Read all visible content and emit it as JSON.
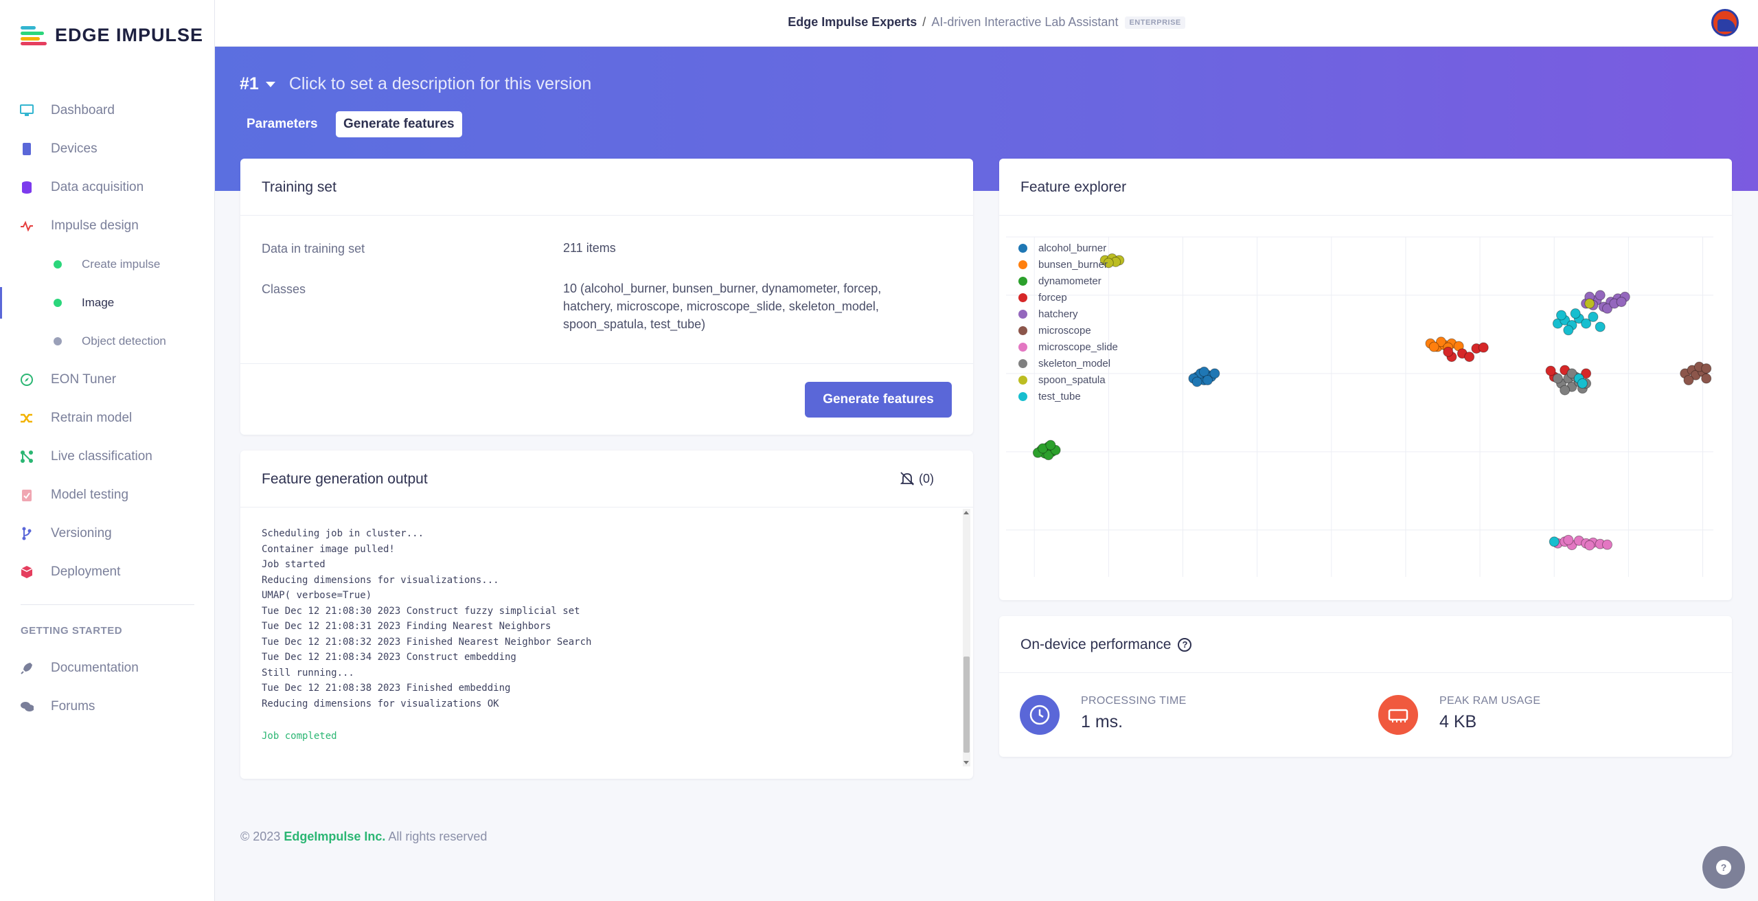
{
  "brand": {
    "name": "EDGE IMPULSE"
  },
  "sidebar": {
    "items": [
      {
        "label": "Dashboard",
        "icon": "monitor-icon",
        "color": "#33b5d0"
      },
      {
        "label": "Devices",
        "icon": "chip-icon",
        "color": "#5a67d8"
      },
      {
        "label": "Data acquisition",
        "icon": "database-icon",
        "color": "#7c3aed"
      },
      {
        "label": "Impulse design",
        "icon": "pulse-icon",
        "color": "#e53e3e"
      },
      {
        "label": "Create impulse",
        "icon": "dot-icon",
        "color": "#2bd67b"
      },
      {
        "label": "Image",
        "icon": "dot-icon",
        "color": "#2bd67b"
      },
      {
        "label": "Object detection",
        "icon": "dot-icon",
        "color": "#9aa0b8"
      },
      {
        "label": "EON Tuner",
        "icon": "compass-icon",
        "color": "#2bb673"
      },
      {
        "label": "Retrain model",
        "icon": "shuffle-icon",
        "color": "#f2b200"
      },
      {
        "label": "Live classification",
        "icon": "network-icon",
        "color": "#2bb673"
      },
      {
        "label": "Model testing",
        "icon": "clipboard-check-icon",
        "color": "#e88a9a"
      },
      {
        "label": "Versioning",
        "icon": "branch-icon",
        "color": "#5a67d8"
      },
      {
        "label": "Deployment",
        "icon": "cube-icon",
        "color": "#e53e5e"
      }
    ],
    "getting_started_title": "GETTING STARTED",
    "getting_started": [
      {
        "label": "Documentation",
        "icon": "rocket-icon"
      },
      {
        "label": "Forums",
        "icon": "chat-icon"
      }
    ]
  },
  "header": {
    "org": "Edge Impulse Experts",
    "separator": "/",
    "project": "AI-driven Interactive Lab Assistant",
    "badge": "ENTERPRISE"
  },
  "banner": {
    "version": "#1",
    "description": "Click to set a description for this version",
    "tabs": [
      {
        "label": "Parameters",
        "active": false
      },
      {
        "label": "Generate features",
        "active": true
      }
    ]
  },
  "training_set": {
    "title": "Training set",
    "rows": [
      {
        "key": "Data in training set",
        "value": "211 items"
      },
      {
        "key": "Classes",
        "value": "10 (alcohol_burner, bunsen_burner, dynamometer, forcep, hatchery, microscope, microscope_slide, skeleton_model, spoon_spatula, test_tube)"
      }
    ],
    "button": "Generate features"
  },
  "output": {
    "title": "Feature generation output",
    "notification_count": "(0)",
    "log": [
      "Scheduling job in cluster...",
      "Container image pulled!",
      "Job started",
      "Reducing dimensions for visualizations...",
      "UMAP( verbose=True)",
      "Tue Dec 12 21:08:30 2023 Construct fuzzy simplicial set",
      "Tue Dec 12 21:08:31 2023 Finding Nearest Neighbors",
      "Tue Dec 12 21:08:32 2023 Finished Nearest Neighbor Search",
      "Tue Dec 12 21:08:34 2023 Construct embedding",
      "Still running...",
      "Tue Dec 12 21:08:38 2023 Finished embedding",
      "Reducing dimensions for visualizations OK"
    ],
    "done": "Job completed"
  },
  "explorer": {
    "title": "Feature explorer",
    "chart_data": {
      "type": "scatter",
      "title": "",
      "xlabel": "",
      "ylabel": "",
      "xlim": [
        0,
        1
      ],
      "ylim": [
        0,
        1
      ],
      "grid": true,
      "legend": "top-left",
      "series": [
        {
          "name": "alcohol_burner",
          "color": "#1f77b4",
          "points": [
            [
              0.27,
              0.58
            ],
            [
              0.28,
              0.57
            ],
            [
              0.275,
              0.59
            ],
            [
              0.285,
              0.585
            ],
            [
              0.265,
              0.575
            ],
            [
              0.29,
              0.58
            ],
            [
              0.28,
              0.595
            ],
            [
              0.27,
              0.565
            ],
            [
              0.285,
              0.57
            ],
            [
              0.295,
              0.59
            ]
          ]
        },
        {
          "name": "bunsen_burner",
          "color": "#ff7f0e",
          "points": [
            [
              0.6,
              0.68
            ],
            [
              0.61,
              0.67
            ],
            [
              0.62,
              0.675
            ],
            [
              0.63,
              0.68
            ],
            [
              0.64,
              0.672
            ],
            [
              0.615,
              0.685
            ],
            [
              0.605,
              0.67
            ],
            [
              0.625,
              0.668
            ]
          ]
        },
        {
          "name": "dynamometer",
          "color": "#2ca02c",
          "points": [
            [
              0.05,
              0.36
            ],
            [
              0.06,
              0.37
            ],
            [
              0.055,
              0.35
            ],
            [
              0.065,
              0.355
            ],
            [
              0.045,
              0.352
            ],
            [
              0.06,
              0.345
            ],
            [
              0.07,
              0.36
            ],
            [
              0.052,
              0.365
            ],
            [
              0.063,
              0.375
            ]
          ]
        },
        {
          "name": "forcep",
          "color": "#d62728",
          "points": [
            [
              0.63,
              0.64
            ],
            [
              0.645,
              0.65
            ],
            [
              0.655,
              0.64
            ],
            [
              0.665,
              0.665
            ],
            [
              0.675,
              0.668
            ],
            [
              0.625,
              0.655
            ],
            [
              0.775,
              0.58
            ],
            [
              0.79,
              0.6
            ],
            [
              0.81,
              0.575
            ],
            [
              0.82,
              0.59
            ],
            [
              0.77,
              0.598
            ]
          ]
        },
        {
          "name": "hatchery",
          "color": "#9467bd",
          "points": [
            [
              0.82,
              0.8
            ],
            [
              0.835,
              0.81
            ],
            [
              0.845,
              0.79
            ],
            [
              0.855,
              0.805
            ],
            [
              0.865,
              0.815
            ],
            [
              0.875,
              0.82
            ],
            [
              0.84,
              0.825
            ],
            [
              0.85,
              0.785
            ],
            [
              0.86,
              0.8
            ],
            [
              0.83,
              0.795
            ],
            [
              0.87,
              0.805
            ],
            [
              0.825,
              0.82
            ]
          ]
        },
        {
          "name": "microscope",
          "color": "#8c564b",
          "points": [
            [
              0.96,
              0.59
            ],
            [
              0.97,
              0.6
            ],
            [
              0.975,
              0.585
            ],
            [
              0.985,
              0.595
            ],
            [
              0.99,
              0.575
            ],
            [
              0.98,
              0.61
            ],
            [
              0.965,
              0.57
            ],
            [
              0.99,
              0.605
            ]
          ]
        },
        {
          "name": "microscope_slide",
          "color": "#e377c2",
          "points": [
            [
              0.78,
              0.08
            ],
            [
              0.79,
              0.085
            ],
            [
              0.8,
              0.075
            ],
            [
              0.81,
              0.088
            ],
            [
              0.82,
              0.08
            ],
            [
              0.83,
              0.082
            ],
            [
              0.84,
              0.078
            ],
            [
              0.85,
              0.076
            ],
            [
              0.795,
              0.09
            ],
            [
              0.825,
              0.074
            ]
          ]
        },
        {
          "name": "skeleton_model",
          "color": "#7f7f7f",
          "points": [
            [
              0.785,
              0.56
            ],
            [
              0.795,
              0.575
            ],
            [
              0.8,
              0.55
            ],
            [
              0.81,
              0.565
            ],
            [
              0.79,
              0.54
            ],
            [
              0.805,
              0.58
            ],
            [
              0.815,
              0.545
            ],
            [
              0.78,
              0.575
            ],
            [
              0.8,
              0.59
            ],
            [
              0.82,
              0.56
            ]
          ]
        },
        {
          "name": "spoon_spatula",
          "color": "#bcbd22",
          "points": [
            [
              0.14,
              0.93
            ],
            [
              0.15,
              0.935
            ],
            [
              0.16,
              0.93
            ],
            [
              0.155,
              0.925
            ],
            [
              0.145,
              0.922
            ],
            [
              0.825,
              0.8
            ]
          ]
        },
        {
          "name": "test_tube",
          "color": "#17becf",
          "points": [
            [
              0.78,
              0.74
            ],
            [
              0.79,
              0.75
            ],
            [
              0.8,
              0.735
            ],
            [
              0.81,
              0.755
            ],
            [
              0.82,
              0.74
            ],
            [
              0.795,
              0.72
            ],
            [
              0.83,
              0.76
            ],
            [
              0.785,
              0.765
            ],
            [
              0.84,
              0.73
            ],
            [
              0.805,
              0.77
            ],
            [
              0.81,
              0.575
            ],
            [
              0.815,
              0.56
            ],
            [
              0.775,
              0.085
            ]
          ]
        }
      ]
    }
  },
  "performance": {
    "title": "On-device performance",
    "help": "?",
    "metrics": [
      {
        "label": "PROCESSING TIME",
        "value": "1 ms.",
        "icon": "clock-icon",
        "color": "#5a67d8"
      },
      {
        "label": "PEAK RAM USAGE",
        "value": "4 KB",
        "icon": "memory-icon",
        "color": "#f0593e"
      }
    ]
  },
  "footer": {
    "copyright": "© 2023",
    "company": "EdgeImpulse Inc.",
    "rights": "All rights reserved"
  },
  "help_fab": {
    "icon": "question-icon"
  }
}
